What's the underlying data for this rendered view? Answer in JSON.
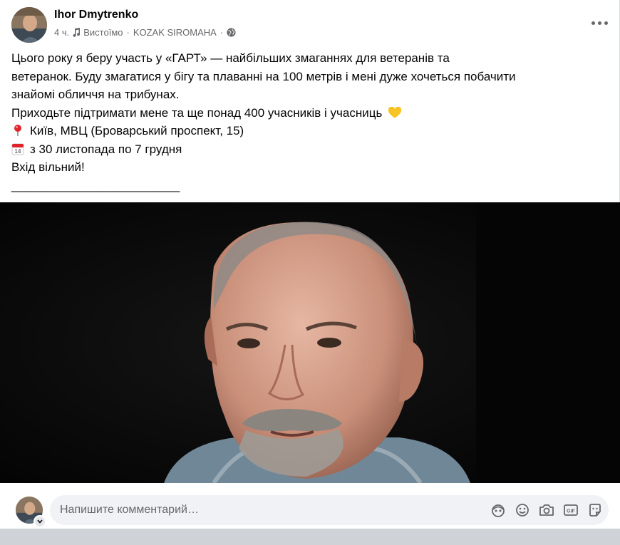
{
  "post": {
    "author": "Ihor Dmytrenko",
    "time": "4 ч.",
    "song": "Вистоїмо",
    "artist": "KOZAK SIROMAHA",
    "separator": "·",
    "audience_icon": "globe-icon",
    "more_icon": "more-horizontal-icon",
    "text": {
      "line1": "Цього року я беру участь у «ГАРТ» — найбільших змаганнях для ветеранів та",
      "line2": "ветеранок. Буду змагатися у бігу та плаванні на 100 метрів і мені дуже хочеться побачити",
      "line3": "знайомі обличчя на трибунах.",
      "line4": "Приходьте підтримати мене та ще понад 400 учасників і учасниць",
      "location": "Київ, МВЦ (Броварський проспект, 15)",
      "dates": "з 30 листопада по 7 грудня",
      "entry": "Вхід вільний!",
      "divider": "_________________________"
    },
    "emoji": {
      "heart": "yellow-heart-icon",
      "pin": "round-pushpin-icon",
      "calendar": "calendar-icon",
      "calendar_day": "14"
    }
  },
  "comment": {
    "placeholder": "Напишите комментарий…",
    "icons": [
      "avatar-sticker-icon",
      "emoji-icon",
      "camera-icon",
      "gif-icon",
      "sticker-icon"
    ],
    "gif_label": "GIF"
  },
  "colors": {
    "text": "#050505",
    "secondary": "#65676b",
    "input_bg": "#f0f2f5",
    "heart": "#f7c325",
    "pin": "#e0242b"
  }
}
